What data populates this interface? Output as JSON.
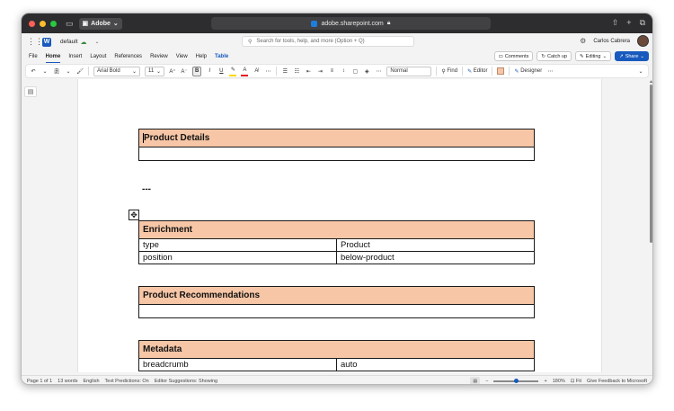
{
  "browser": {
    "profile": "Adobe",
    "url": "adobe.sharepoint.com",
    "accent": "#1f7ddb"
  },
  "app": {
    "doc_name": "default",
    "search_placeholder": "Search for tools, help, and more (Option + Q)",
    "user_name": "Carlos Cabrera",
    "word_color": "#185abd"
  },
  "tabs": [
    "File",
    "Home",
    "Insert",
    "Layout",
    "References",
    "Review",
    "View",
    "Help",
    "Table"
  ],
  "tab_actions": {
    "comments": "Comments",
    "catch_up": "Catch up",
    "editing": "Editing",
    "share": "Share"
  },
  "ribbon": {
    "font_name": "Arial Bold",
    "font_size": "11",
    "style": "Normal",
    "find": "Find",
    "editor": "Editor",
    "designer": "Designer"
  },
  "document": {
    "header_color": "#f6c6a6",
    "separator": "---",
    "blocks": [
      {
        "title": "Product Details",
        "rows": []
      },
      {
        "title": "Enrichment",
        "rows": [
          [
            "type",
            "Product"
          ],
          [
            "position",
            "below-product"
          ]
        ]
      },
      {
        "title": "Product Recommendations",
        "rows": []
      },
      {
        "title": "Metadata",
        "rows": [
          [
            "breadcrumb",
            "auto"
          ]
        ]
      }
    ]
  },
  "status": {
    "page": "Page 1 of 1",
    "words": "13 words",
    "language": "English",
    "predictions": "Text Predictions: On",
    "suggestions": "Editor Suggestions: Showing",
    "zoom": "180%",
    "fit": "Fit",
    "feedback": "Give Feedback to Microsoft",
    "zoom_fraction": 0.45
  }
}
